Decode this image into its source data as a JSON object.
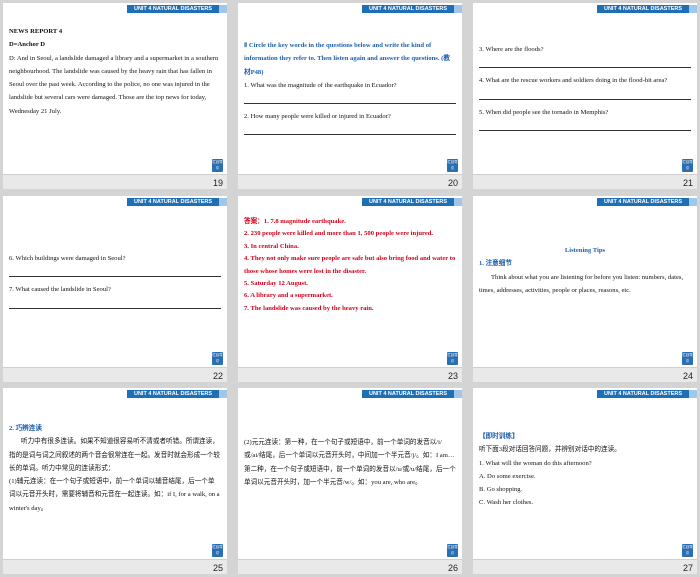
{
  "header_label": "UNIT 4 NATURAL DISASTERS",
  "nav_button_label": "栏目导引",
  "slides": [
    {
      "page": "19",
      "title": "NEWS REPORT 4",
      "subtitle": "D=Anchor D",
      "body": "D: And in Seoul, a landslide damaged a library and a supermarket in a southern neighbourhood. The landslide was caused by the heavy rain that has fallen in Seoul over the past week. According to the police, no one was injured in the landslide but several cars were damaged. Those are the top news for today, Wednesday 21 July."
    },
    {
      "page": "20",
      "instruction": "Ⅱ Circle the key words in the questions below and write the kind of information they refer to. Then listen again and answer the questions. (教材P48)",
      "q1": "1. What was the magnitude of the earthquake in Ecuador?",
      "q2": "2. How many people were killed or injured in Ecuador?"
    },
    {
      "page": "21",
      "q3": "3. Where are the floods?",
      "q4": "4. What are the rescue workers and soldiers doing in the flood-hit area?",
      "q5": "5. When did people see the tornado in Memphis?"
    },
    {
      "page": "22",
      "q6": "6. Which buildings were damaged in Seoul?",
      "q7": "7. What caused the landslide in Seoul?"
    },
    {
      "page": "23",
      "answers": [
        "答案：1. 7.8 magnitude earthquake.",
        "2. 230 people were killed and more than 1, 500 people were injured.",
        "3. In central China.",
        "4. They not only make sure people are safe but also bring food and water to those whose homes were lost in the disaster.",
        "5. Saturday 12 August.",
        "6. A library and a supermarket.",
        "7. The landslide was caused by the heavy rain."
      ]
    },
    {
      "page": "24",
      "title": "Listening Tips",
      "heading": "1. 注意细节",
      "body": "Think about what you are listening for before you listen: numbers, dates, times, addresses, activities, people or places, reasons, etc."
    },
    {
      "page": "25",
      "heading": "2. 巧辨连读",
      "body1": "听力中有很多连读。如果不知道很容易听不清或者听错。所谓连读，指的是词与词之间叙述的两个音会很常连在一起。发音时就会形成一个较长的单词。听力中常见的连读形式：",
      "body2": "(1)辅元连读：在一个句子或短语中，前一个单词以辅音结尾，后一个单词以元音开头时，需要将辅音和元音在一起连读。如：if I, for a walk, on a winter's day。"
    },
    {
      "page": "26",
      "body": "(2)元元连读：第一种，在一个句子或短语中，前一个单词的发音以/i/或/ai/结尾，后一个单词以元音开头时，中间加一个半元音/j/。如：I am… 第二种，在一个句子或短语中，前一个单词的发音以/u/或/u/结尾，后一个单词以元音开头时，加一个半元音/w/。如：you are, who are。"
    },
    {
      "page": "27",
      "heading": "【即时训练】",
      "instruction": "听下面3段对话回答问题，并辨别对话中的连读。",
      "question": "1. What will the woman do this afternoon?",
      "options": [
        "A. Do some exercise.",
        "B. Go shopping.",
        "C. Wash her clothes."
      ]
    }
  ]
}
